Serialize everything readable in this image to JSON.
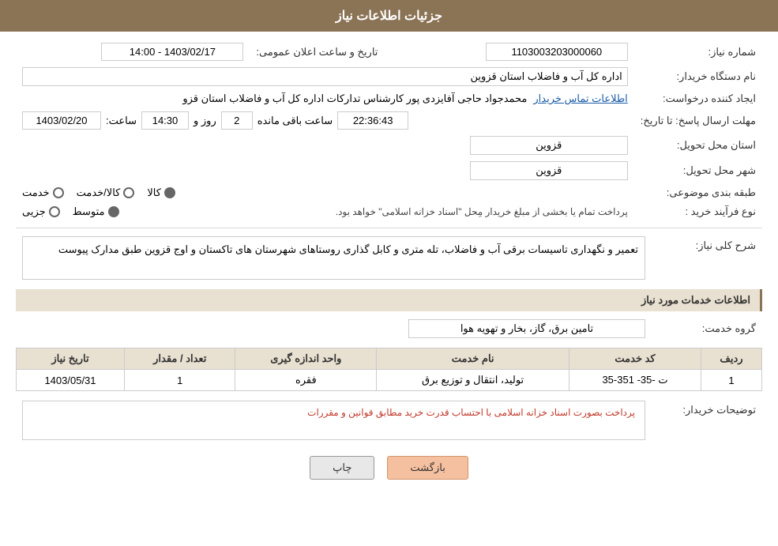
{
  "header": {
    "title": "جزئیات اطلاعات نیاز"
  },
  "fields": {
    "need_number_label": "شماره نیاز:",
    "need_number_value": "1103003203000060",
    "announcement_date_label": "تاریخ و ساعت اعلان عمومی:",
    "announcement_date_value": "1403/02/17 - 14:00",
    "buyer_org_label": "نام دستگاه خریدار:",
    "buyer_org_value": "اداره کل آب و فاضلاب استان قزوین",
    "requester_label": "ایجاد کننده درخواست:",
    "requester_name": "محمدجواد حاجی آفایزدی پور کارشناس تدارکات اداره کل آب و فاضلاب استان قزو",
    "requester_link": "اطلاعات تماس خریدار",
    "response_deadline_label": "مهلت ارسال پاسخ: تا تاریخ:",
    "response_date": "1403/02/20",
    "response_time_label": "ساعت:",
    "response_time": "14:30",
    "response_days_label": "روز و",
    "response_days": "2",
    "response_remaining_label": "ساعت باقی مانده",
    "response_remaining": "22:36:43",
    "province_label": "استان محل تحویل:",
    "province_value": "قزوین",
    "city_label": "شهر محل تحویل:",
    "city_value": "قزوین",
    "category_label": "طبقه بندی موضوعی:",
    "category_options": [
      "خدمت",
      "کالا/خدمت",
      "کالا"
    ],
    "category_selected": "کالا",
    "purchase_type_label": "نوع فرآیند خرید :",
    "purchase_options": [
      "جزیی",
      "متوسط"
    ],
    "purchase_note": "پرداخت تمام یا بخشی از مبلغ خریدار مِحل \"اسناد خزانه اسلامی\" خواهد بود.",
    "general_desc_label": "شرح کلی نیاز:",
    "general_desc_value": "تعمیر و نگهداری تاسیسات برقی آب و فاضلاب، تله متری و کابل گذاری روستاهای شهرستان های تاکستان و اوج قزوین طبق مدارک پیوست",
    "services_section_label": "اطلاعات خدمات مورد نیاز",
    "service_group_label": "گروه خدمت:",
    "service_group_value": "تامین برق، گاز، بخار و تهویه هوا",
    "table": {
      "columns": [
        "ردیف",
        "کد خدمت",
        "نام خدمت",
        "واحد اندازه گیری",
        "تعداد / مقدار",
        "تاریخ نیاز"
      ],
      "rows": [
        {
          "row": "1",
          "code": "ت -35- 351-35",
          "name": "تولید، انتقال و توزیع برق",
          "unit": "فقره",
          "count": "1",
          "date": "1403/05/31"
        }
      ]
    },
    "buyer_desc_label": "توضیحات خریدار:",
    "buyer_desc_value": "پرداخت بصورت اسناد خزانه اسلامی با احتساب قدرت خرید مطابق قوانین و مقررات"
  },
  "buttons": {
    "print_label": "چاپ",
    "back_label": "بازگشت"
  }
}
